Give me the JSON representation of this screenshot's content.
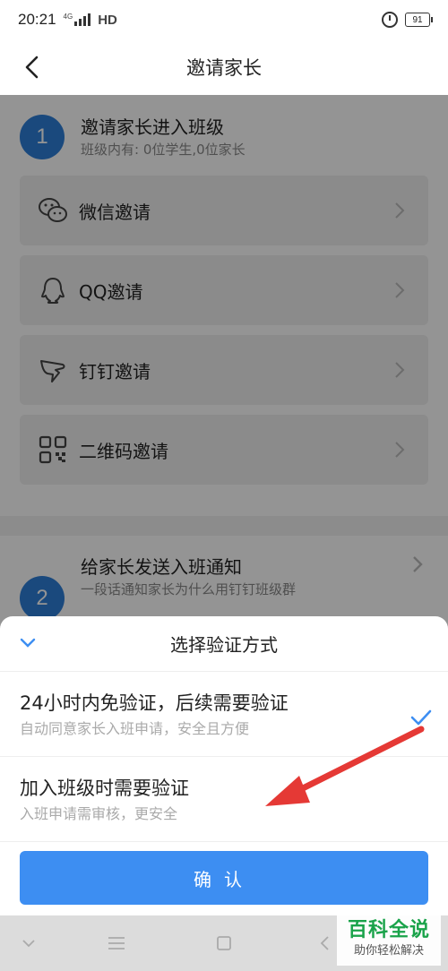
{
  "status_bar": {
    "time": "20:21",
    "network": "HD",
    "signal_tag": "4G",
    "battery": "91"
  },
  "nav": {
    "title": "邀请家长"
  },
  "section1": {
    "step": "1",
    "title": "邀请家长进入班级",
    "subtitle": "班级内有: 0位学生,0位家长",
    "options": [
      {
        "label": "微信邀请",
        "icon": "wechat-icon"
      },
      {
        "label": "QQ邀请",
        "icon": "qq-icon"
      },
      {
        "label": "钉钉邀请",
        "icon": "dingtalk-icon"
      },
      {
        "label": "二维码邀请",
        "icon": "qrcode-icon"
      }
    ]
  },
  "section2": {
    "step": "2",
    "title": "给家长发送入班通知",
    "subtitle": "一段话通知家长为什么用钉钉班级群"
  },
  "sheet": {
    "title": "选择验证方式",
    "choices": [
      {
        "title": "24小时内免验证，后续需要验证",
        "subtitle": "自动同意家长入班申请，安全且方便",
        "selected": true
      },
      {
        "title": "加入班级时需要验证",
        "subtitle": "入班申请需审核，更安全",
        "selected": false
      }
    ],
    "confirm_label": "确认"
  },
  "watermark": {
    "main": "百科全说",
    "sub": "助你轻松解决"
  },
  "colors": {
    "accent": "#3d8ef2",
    "step_circle": "#2d7ed8",
    "annotation": "#e53935",
    "watermark": "#1aa34a"
  }
}
